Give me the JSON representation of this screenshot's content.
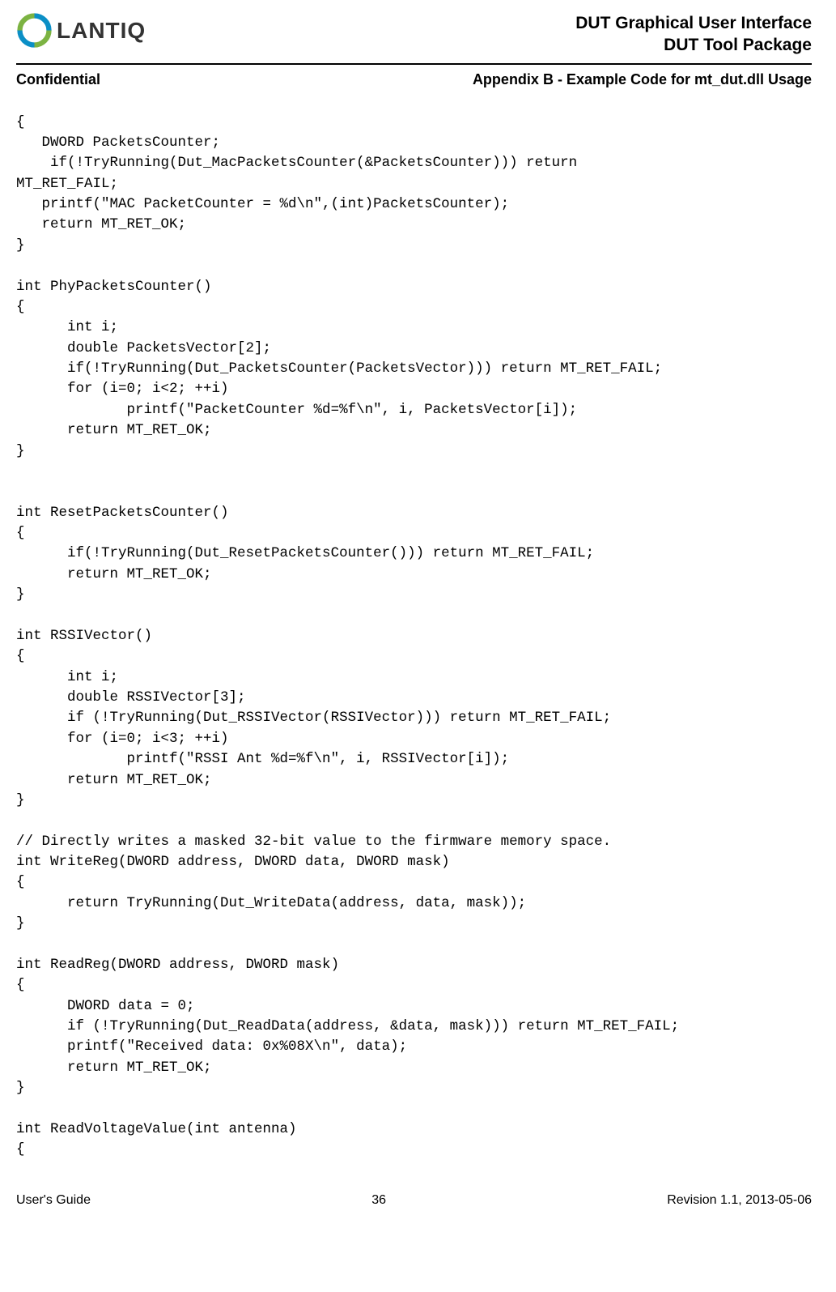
{
  "header": {
    "logo_text": "LANTIQ",
    "title_line1": "DUT Graphical User Interface",
    "title_line2": "DUT Tool Package"
  },
  "sub_header": {
    "left": "Confidential",
    "right": "Appendix B - Example Code for mt_dut.dll Usage"
  },
  "code": "{\n   DWORD PacketsCounter;\n    if(!TryRunning(Dut_MacPacketsCounter(&PacketsCounter))) return\nMT_RET_FAIL;\n   printf(\"MAC PacketCounter = %d\\n\",(int)PacketsCounter);\n   return MT_RET_OK;\n}\n\nint PhyPacketsCounter()\n{\n      int i;\n      double PacketsVector[2];\n      if(!TryRunning(Dut_PacketsCounter(PacketsVector))) return MT_RET_FAIL;\n      for (i=0; i<2; ++i)\n             printf(\"PacketCounter %d=%f\\n\", i, PacketsVector[i]);\n      return MT_RET_OK;\n}\n\n\nint ResetPacketsCounter()\n{\n      if(!TryRunning(Dut_ResetPacketsCounter())) return MT_RET_FAIL;\n      return MT_RET_OK;\n}\n\nint RSSIVector()\n{\n      int i;\n      double RSSIVector[3];\n      if (!TryRunning(Dut_RSSIVector(RSSIVector))) return MT_RET_FAIL;\n      for (i=0; i<3; ++i)\n             printf(\"RSSI Ant %d=%f\\n\", i, RSSIVector[i]);\n      return MT_RET_OK;\n}\n\n// Directly writes a masked 32-bit value to the firmware memory space.\nint WriteReg(DWORD address, DWORD data, DWORD mask)\n{\n      return TryRunning(Dut_WriteData(address, data, mask));\n}\n\nint ReadReg(DWORD address, DWORD mask)\n{\n      DWORD data = 0;\n      if (!TryRunning(Dut_ReadData(address, &data, mask))) return MT_RET_FAIL;\n      printf(\"Received data: 0x%08X\\n\", data);\n      return MT_RET_OK;\n}\n\nint ReadVoltageValue(int antenna)\n{",
  "footer": {
    "left": "User's Guide",
    "center": "36",
    "right": "Revision 1.1, 2013-05-06"
  }
}
